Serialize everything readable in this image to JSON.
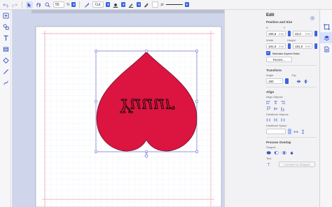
{
  "toolbar": {
    "zoom_value": "55",
    "zoom_unit": "%",
    "cut_label": "Cut",
    "unit_label": "pt"
  },
  "panel": {
    "title": "Edit",
    "position_size": {
      "section_label": "Position and Size",
      "x_label": "X",
      "y_label": "Y",
      "x_value": "195,6",
      "y_value": "33,3",
      "width_label": "Width",
      "height_label": "Height",
      "width_value": "181,0",
      "height_value": "181,0",
      "unit": "mm",
      "maintain_aspect_label": "Maintain Aspect Ratio",
      "resize_label": "Resize..."
    },
    "transform": {
      "section_label": "Transform",
      "angle_label": "Angle",
      "flip_label": "Flip",
      "angle_value": "180",
      "angle_unit": "°"
    },
    "align": {
      "section_label": "Align",
      "align_objects_label": "Align Objects",
      "distribute_objects_label": "Distribute Objects",
      "distribute_space_label": "Distribute Space"
    },
    "process_overlap": {
      "section_label": "Process Overlap",
      "shapes_label": "Shapes",
      "text_label": "Text",
      "convert_label": "Convert to Shapes"
    }
  },
  "canvas": {
    "text_content": "Yuuur",
    "heart_color": "#dc1440"
  },
  "colors": {
    "accent": "#3b63e0",
    "workspace": "#cfd5ea",
    "selection": "#5a5ad8",
    "margin_line": "#e8a0a8"
  }
}
